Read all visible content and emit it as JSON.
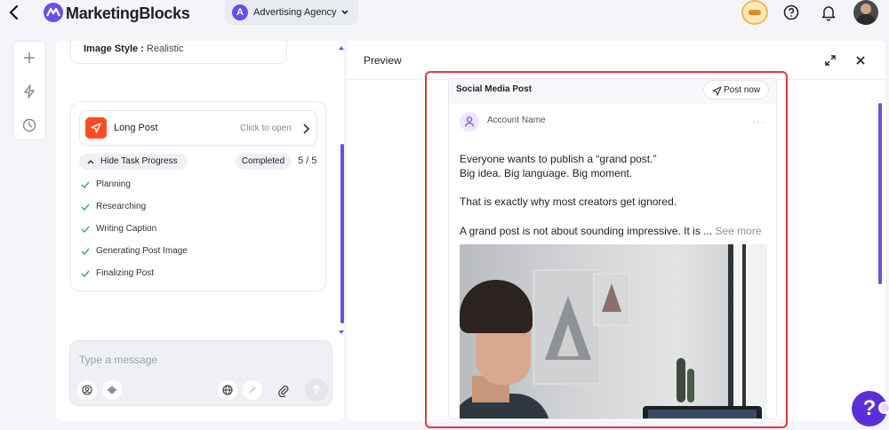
{
  "app": {
    "brand": "MarketingBlocks",
    "workspace_initial": "A",
    "workspace_name": "Advertising Agency"
  },
  "chat": {
    "image_style_label": "Image Style :",
    "image_style_value": "Realistic",
    "task": {
      "title": "Long Post",
      "open_hint": "Click to open",
      "toggle_label": "Hide Task Progress",
      "status": "Completed",
      "progress": "5 / 5",
      "steps": [
        "Planning",
        "Researching",
        "Writing Caption",
        "Generating Post Image",
        "Finalizing Post"
      ]
    },
    "composer": {
      "placeholder": "Type a message"
    }
  },
  "preview": {
    "title": "Preview",
    "card_title": "Social Media Post",
    "post_now_label": "Post now",
    "account_name": "Account Name",
    "more_dots": "···",
    "lines": [
      "Everyone wants to publish a “grand post.”",
      "Big idea. Big language. Big moment.",
      "That is exactly why most creators get ignored.",
      "A grand post is not about sounding impressive. It is ..."
    ],
    "see_more": "See more"
  },
  "help": {
    "glyph": "?"
  },
  "colors": {
    "accent": "#6b4ee6",
    "highlight": "#e03a3a",
    "post_icon": "#ff4d1f"
  }
}
